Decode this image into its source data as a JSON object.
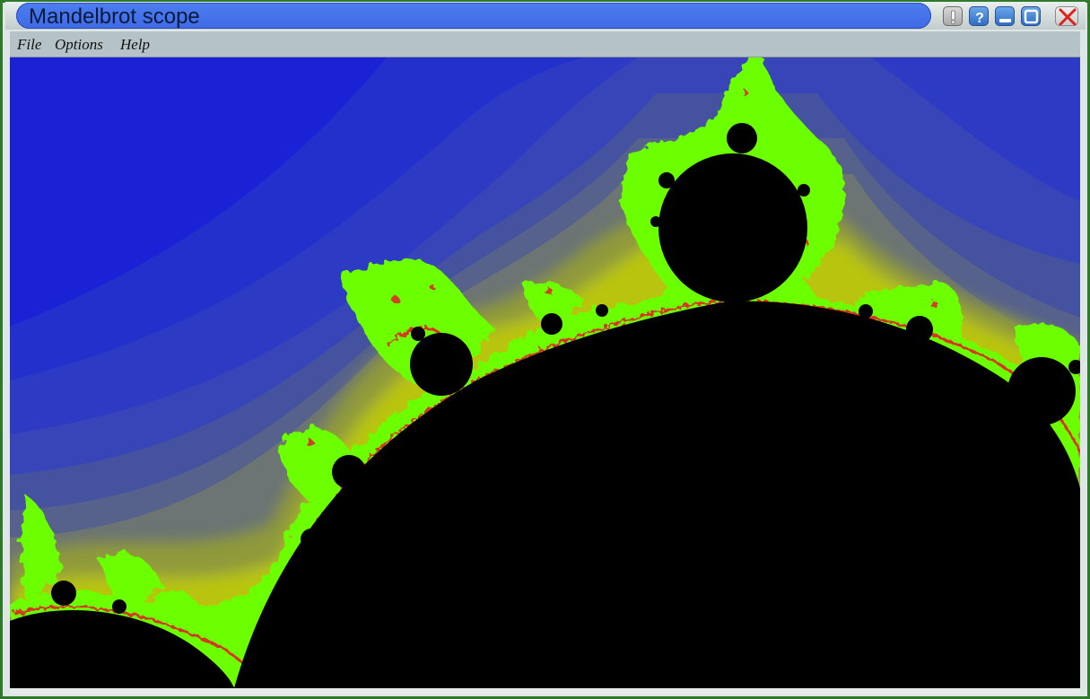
{
  "window": {
    "title": "Mandelbrot scope",
    "buttons": {
      "alert": "!",
      "help": "?"
    }
  },
  "menu": {
    "items": [
      "File",
      "Options",
      "Help"
    ]
  },
  "colors": {
    "frame": "#2f7a2a",
    "title_bar": "#4676ec",
    "menu_bar": "#b5c3c8",
    "set_interior": "#000000",
    "background_far": "#1c21d8",
    "band_near": "#c9d400",
    "filament_green": "#6cff00",
    "filament_red": "#e0202a"
  }
}
